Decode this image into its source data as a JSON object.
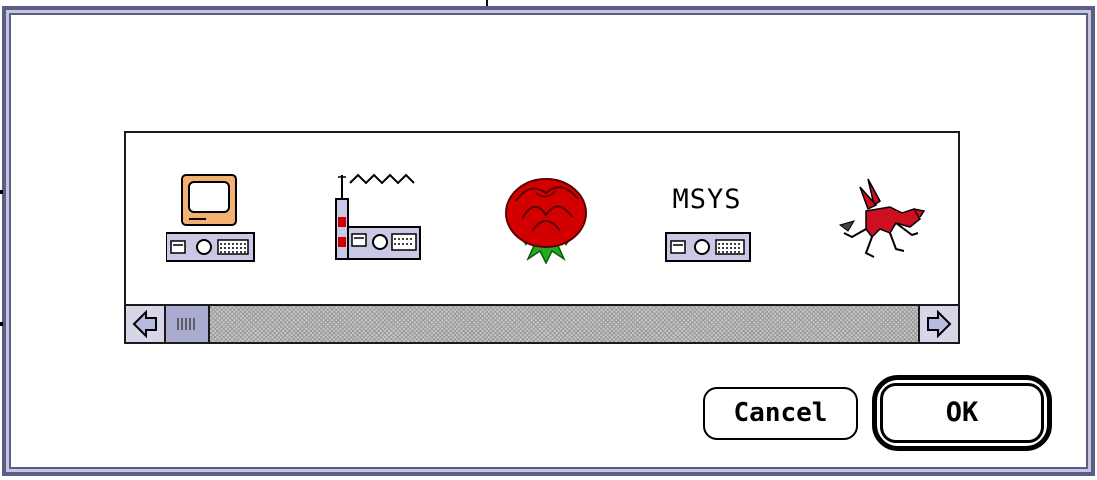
{
  "dialog": {
    "icons": [
      {
        "name": "computer-network-icon"
      },
      {
        "name": "radio-network-icon"
      },
      {
        "name": "rose-icon"
      },
      {
        "name": "msys-network-icon",
        "label": "MSYS"
      },
      {
        "name": "pegasus-icon"
      }
    ],
    "scrollbar": {
      "left_arrow": "left-arrow-icon",
      "right_arrow": "right-arrow-icon",
      "position": 0.0
    },
    "buttons": {
      "cancel_label": "Cancel",
      "ok_label": "OK"
    }
  },
  "colors": {
    "frame": "#5a5e86",
    "frame_light": "#c5c5dd",
    "accent": "#a9abd0",
    "rose_red": "#d40000",
    "leaf_green": "#22aa22",
    "monitor_tan": "#f0b070"
  }
}
